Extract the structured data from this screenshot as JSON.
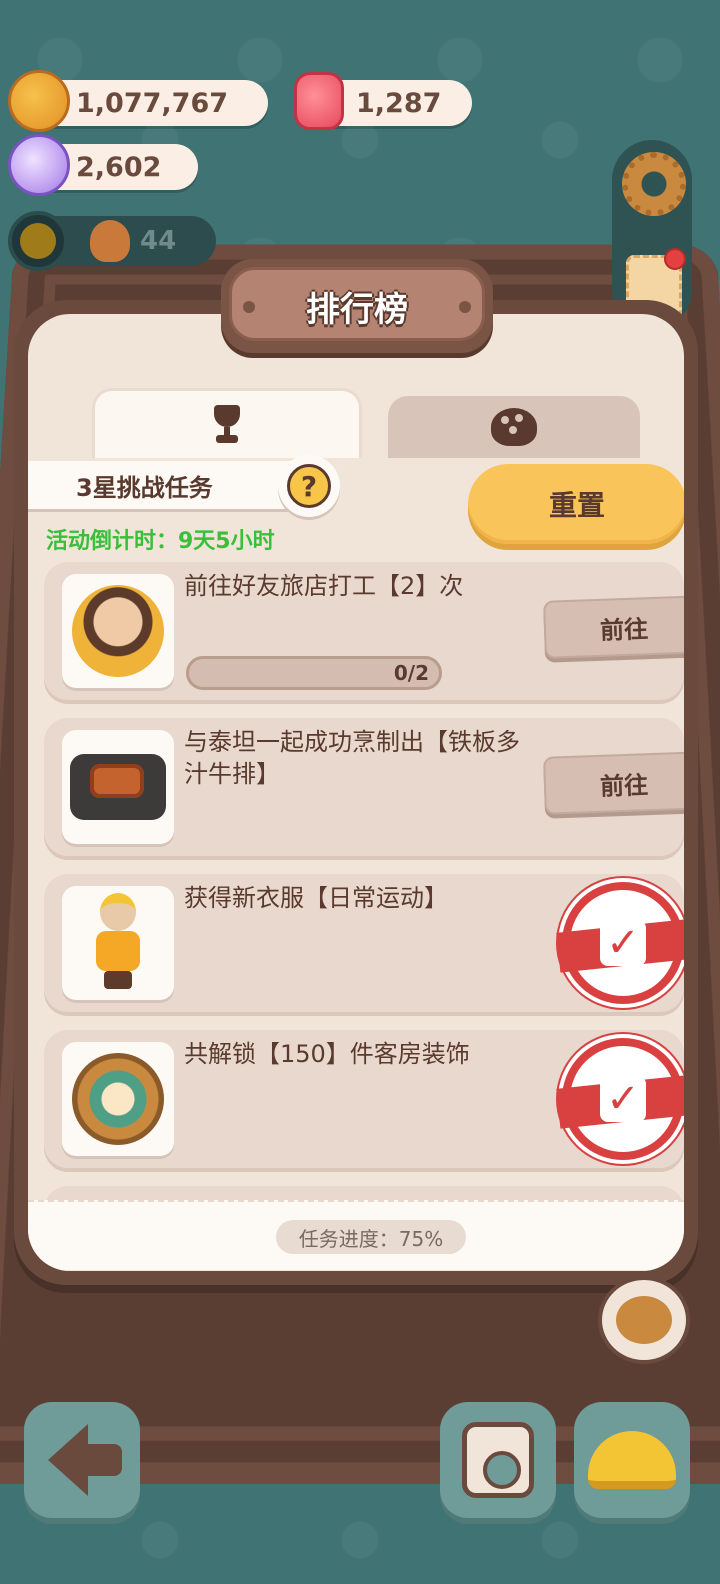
{
  "hud": {
    "cookies": "1,077,767",
    "gems": "1,287",
    "candy": "2,602",
    "level_count": "44"
  },
  "panel": {
    "title": "排行榜",
    "tabs": [
      {
        "icon": "trophy-icon",
        "active": true
      },
      {
        "icon": "ball-icon",
        "active": false
      }
    ],
    "task_group_label": "3星挑战任务",
    "help_label": "?",
    "countdown": "活动倒计时：9天5小时",
    "reset_label": "重置",
    "overall_progress": "任务进度：75%"
  },
  "tasks": [
    {
      "title": "前往好友旅店打工【2】次",
      "progress_text": "0/2",
      "progress": 0,
      "status": "go",
      "button_label": "前往",
      "thumb": "worker"
    },
    {
      "title": "与泰坦一起成功烹制出【铁板多汁牛排】",
      "status": "go",
      "button_label": "前往",
      "thumb": "steak"
    },
    {
      "title": "获得新衣服【日常运动】",
      "status": "done",
      "thumb": "outfit"
    },
    {
      "title": "共解锁【150】件客房装饰",
      "status": "done",
      "thumb": "decor"
    }
  ],
  "colors": {
    "background": "#3f7374",
    "panel_wood": "#6b4a3e",
    "panel_paper": "#f1e5da",
    "accent_yellow": "#f9c55a",
    "countdown_green": "#3bbf3a",
    "stamp_red": "#d94040"
  }
}
